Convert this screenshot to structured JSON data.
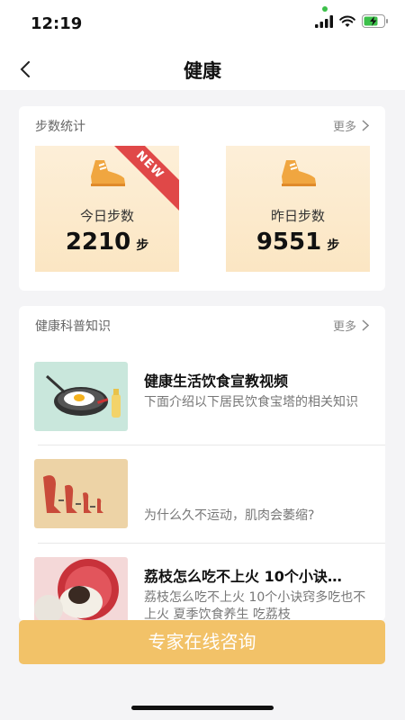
{
  "status_bar": {
    "time": "12:19"
  },
  "header": {
    "title": "健康"
  },
  "steps": {
    "section_title": "步数统计",
    "more_label": "更多",
    "today": {
      "label": "今日步数",
      "value": "2210",
      "unit": "步",
      "badge": "NEW"
    },
    "yesterday": {
      "label": "昨日步数",
      "value": "9551",
      "unit": "步"
    }
  },
  "knowledge": {
    "section_title": "健康科普知识",
    "more_label": "更多",
    "articles": [
      {
        "title": "健康生活饮食宣教视频",
        "desc": "下面介绍以下居民饮食宝塔的相关知识",
        "thumb": "frying-pan-egg"
      },
      {
        "title": "",
        "desc": "为什么久不运动，肌肉会萎缩?",
        "thumb": "shrinking-legs"
      },
      {
        "title": "荔枝怎么吃不上火 10个小诀…",
        "desc": "荔枝怎么吃不上火 10个小诀窍多吃也不上火 夏季饮食养生 吃荔枝",
        "thumb": "lychee"
      }
    ]
  },
  "footer": {
    "consult_label": "专家在线咨询"
  },
  "colors": {
    "accent": "#f2c268",
    "card_bg": "#fbe6c3",
    "badge": "#e04848"
  }
}
